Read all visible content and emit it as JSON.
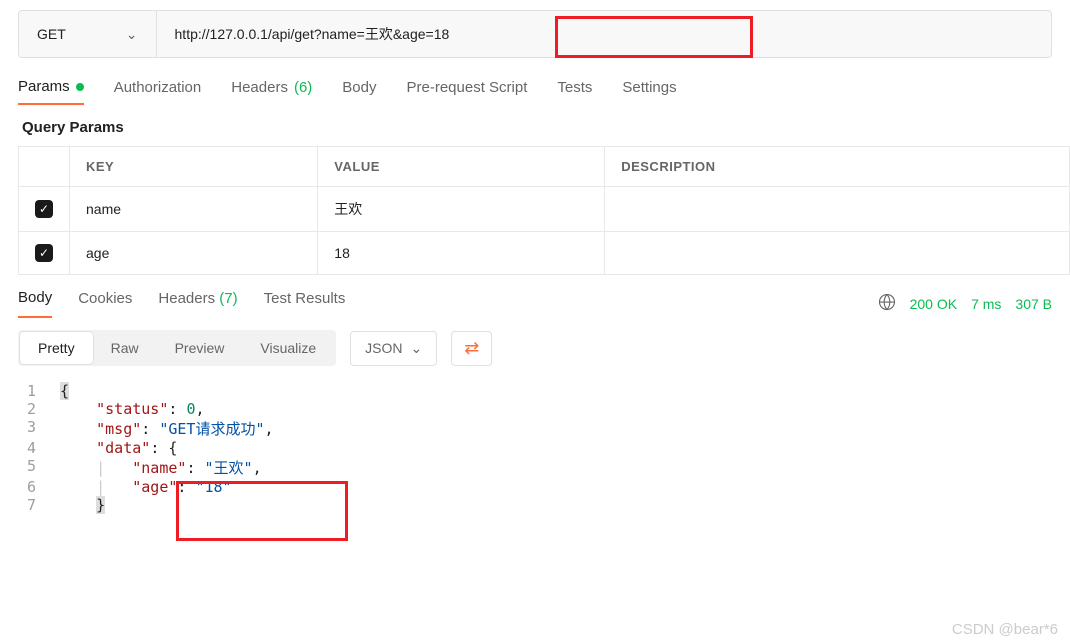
{
  "request": {
    "method": "GET",
    "url": "http://127.0.0.1/api/get?name=王欢&age=18"
  },
  "tabs": {
    "params": "Params",
    "authorization": "Authorization",
    "headers": "Headers",
    "headers_count": "(6)",
    "body": "Body",
    "prerequest": "Pre-request Script",
    "tests": "Tests",
    "settings": "Settings"
  },
  "query_params": {
    "title": "Query Params",
    "columns": {
      "key": "KEY",
      "value": "VALUE",
      "description": "DESCRIPTION"
    },
    "rows": [
      {
        "key": "name",
        "value": "王欢"
      },
      {
        "key": "age",
        "value": "18"
      }
    ]
  },
  "response_tabs": {
    "body": "Body",
    "cookies": "Cookies",
    "headers": "Headers",
    "headers_count": "(7)",
    "test_results": "Test Results"
  },
  "response_meta": {
    "status": "200 OK",
    "time": "7 ms",
    "size": "307 B"
  },
  "view": {
    "pretty": "Pretty",
    "raw": "Raw",
    "preview": "Preview",
    "visualize": "Visualize",
    "format": "JSON"
  },
  "response_json": {
    "status_key": "\"status\"",
    "status_val": "0",
    "msg_key": "\"msg\"",
    "msg_val": "\"GET请求成功\"",
    "data_key": "\"data\"",
    "name_key": "\"name\"",
    "name_val": "\"王欢\"",
    "age_key": "\"age\"",
    "age_val": "\"18\""
  },
  "watermark": "CSDN @bear*6"
}
